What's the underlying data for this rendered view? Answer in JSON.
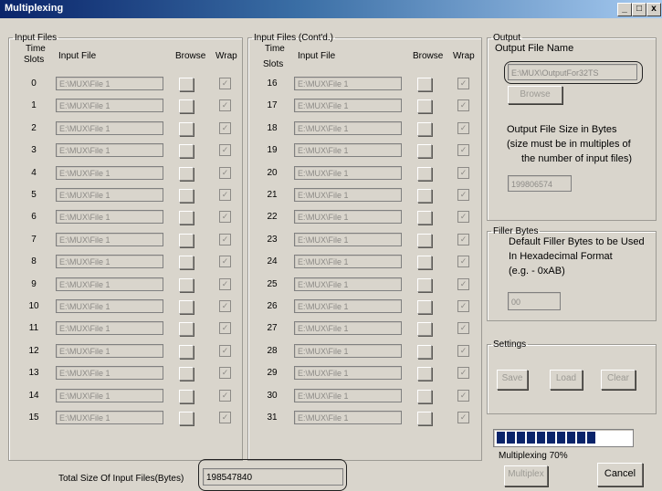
{
  "window": {
    "title": "Multiplexing",
    "minimize": "_",
    "maximize": "□",
    "close": "x"
  },
  "input_files": {
    "legend": "Input Files",
    "col_time_slots": "Time Slots",
    "col_time_top": "Time",
    "col_time_bottom": "Slots",
    "col_input_file": "Input File",
    "col_browse": "Browse",
    "col_wrap": "Wrap",
    "rows": [
      {
        "slot": "0",
        "file": "E:\\MUX\\File 1"
      },
      {
        "slot": "1",
        "file": "E:\\MUX\\File 1"
      },
      {
        "slot": "2",
        "file": "E:\\MUX\\File 1"
      },
      {
        "slot": "3",
        "file": "E:\\MUX\\File 1"
      },
      {
        "slot": "4",
        "file": "E:\\MUX\\File 1"
      },
      {
        "slot": "5",
        "file": "E:\\MUX\\File 1"
      },
      {
        "slot": "6",
        "file": "E:\\MUX\\File 1"
      },
      {
        "slot": "7",
        "file": "E:\\MUX\\File 1"
      },
      {
        "slot": "8",
        "file": "E:\\MUX\\File 1"
      },
      {
        "slot": "9",
        "file": "E:\\MUX\\File 1"
      },
      {
        "slot": "10",
        "file": "E:\\MUX\\File 1"
      },
      {
        "slot": "11",
        "file": "E:\\MUX\\File 1"
      },
      {
        "slot": "12",
        "file": "E:\\MUX\\File 1"
      },
      {
        "slot": "13",
        "file": "E:\\MUX\\File 1"
      },
      {
        "slot": "14",
        "file": "E:\\MUX\\File 1"
      },
      {
        "slot": "15",
        "file": "E:\\MUX\\File 1"
      }
    ]
  },
  "input_files_contd": {
    "legend": "Input Files (Cont'd.)",
    "col_time_top": "Time",
    "col_time_bottom": "Slots",
    "col_input_file": "Input File",
    "col_browse": "Browse",
    "col_wrap": "Wrap",
    "rows": [
      {
        "slot": "16",
        "file": "E:\\MUX\\File 1"
      },
      {
        "slot": "17",
        "file": "E:\\MUX\\File 1"
      },
      {
        "slot": "18",
        "file": "E:\\MUX\\File 1"
      },
      {
        "slot": "19",
        "file": "E:\\MUX\\File 1"
      },
      {
        "slot": "20",
        "file": "E:\\MUX\\File 1"
      },
      {
        "slot": "21",
        "file": "E:\\MUX\\File 1"
      },
      {
        "slot": "22",
        "file": "E:\\MUX\\File 1"
      },
      {
        "slot": "23",
        "file": "E:\\MUX\\File 1"
      },
      {
        "slot": "24",
        "file": "E:\\MUX\\File 1"
      },
      {
        "slot": "25",
        "file": "E:\\MUX\\File 1"
      },
      {
        "slot": "26",
        "file": "E:\\MUX\\File 1"
      },
      {
        "slot": "27",
        "file": "E:\\MUX\\File 1"
      },
      {
        "slot": "28",
        "file": "E:\\MUX\\File 1"
      },
      {
        "slot": "29",
        "file": "E:\\MUX\\File 1"
      },
      {
        "slot": "30",
        "file": "E:\\MUX\\File 1"
      },
      {
        "slot": "31",
        "file": "E:\\MUX\\File 1"
      }
    ]
  },
  "wrap_checked": true,
  "output": {
    "legend": "Output",
    "file_name_label": "Output File Name",
    "file_name_value": "E:\\MUX\\OutputFor32TS",
    "browse_label": "Browse",
    "size_label_1": "Output File Size in Bytes",
    "size_label_2": "(size must be in multiples of",
    "size_label_3": "the number of input files)",
    "size_value": "199806574"
  },
  "filler": {
    "legend": "Filler Bytes",
    "desc_1": "Default Filler Bytes to be Used",
    "desc_2": "In Hexadecimal Format",
    "desc_3": "(e.g. - 0xAB)",
    "value": "00"
  },
  "settings": {
    "legend": "Settings",
    "save_label": "Save",
    "load_label": "Load",
    "clear_label": "Clear"
  },
  "progress": {
    "percent": 70,
    "blocks_filled": 10,
    "status": "Multiplexing 70%"
  },
  "footer": {
    "total_size_label": "Total Size Of Input Files(Bytes)",
    "total_size_value": "198547840",
    "multiplex_label": "Multiplex",
    "cancel_label": "Cancel"
  },
  "colors": {
    "title_bar_start": "#0a246a",
    "title_bar_end": "#a6caf0",
    "progress_fill": "#0a246a",
    "dialog_bg": "#d9d5cc"
  }
}
